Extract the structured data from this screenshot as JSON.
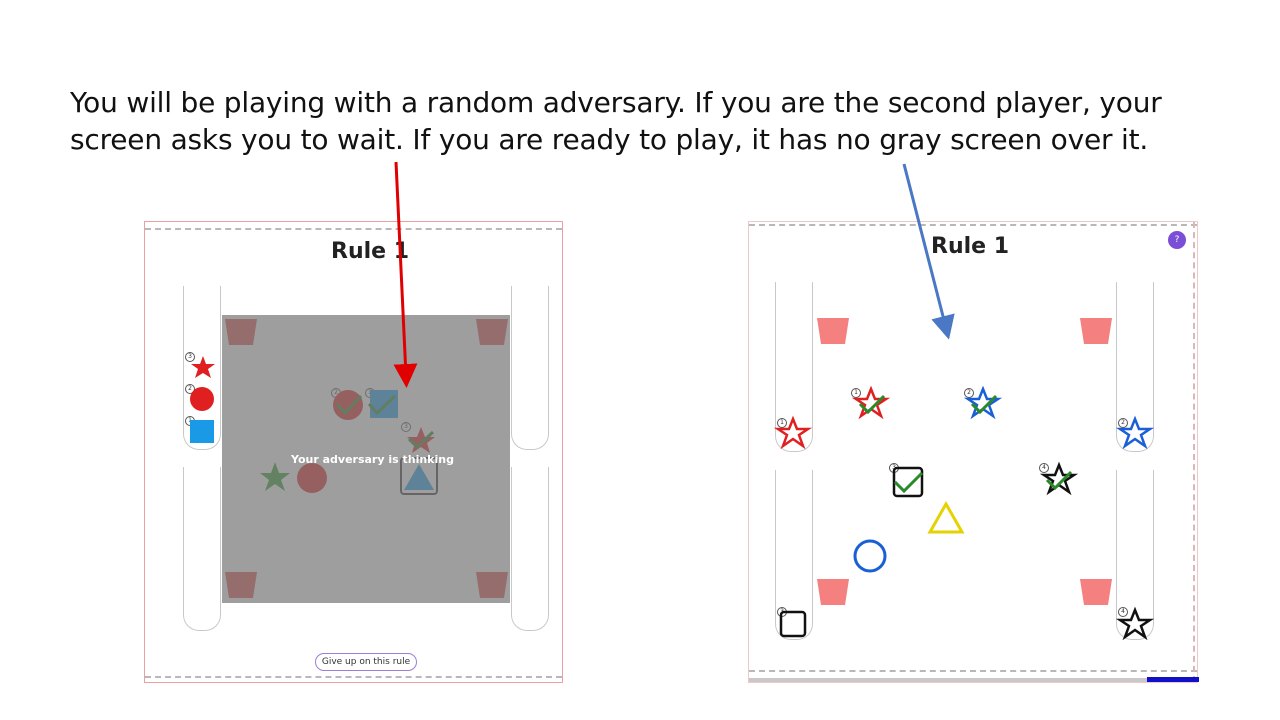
{
  "instruction": "You will be playing with a random adversary. If you are the second player, your screen asks you to wait. If you are ready to play, it has no gray screen over it.",
  "left_panel": {
    "title": "Rule 1",
    "overlay_text": "Your adversary is thinking",
    "give_up_label": "Give up on this rule",
    "left_rail_numbers": [
      "3",
      "2",
      "1"
    ],
    "board_numbers": [
      "2",
      "1",
      "3"
    ]
  },
  "right_panel": {
    "title": "Rule 1",
    "help_label": "?",
    "rail_numbers": [
      "1",
      "2",
      "3",
      "4"
    ],
    "board_numbers": [
      "1",
      "2",
      "3",
      "4"
    ]
  },
  "colors": {
    "red": "#e02020",
    "blue": "#1a7fd6",
    "green": "#2a8a2a",
    "bucket": "#f08080",
    "arrow_red": "#e00000",
    "arrow_blue": "#4a78c4",
    "accent_purple": "#7b4ed8"
  }
}
